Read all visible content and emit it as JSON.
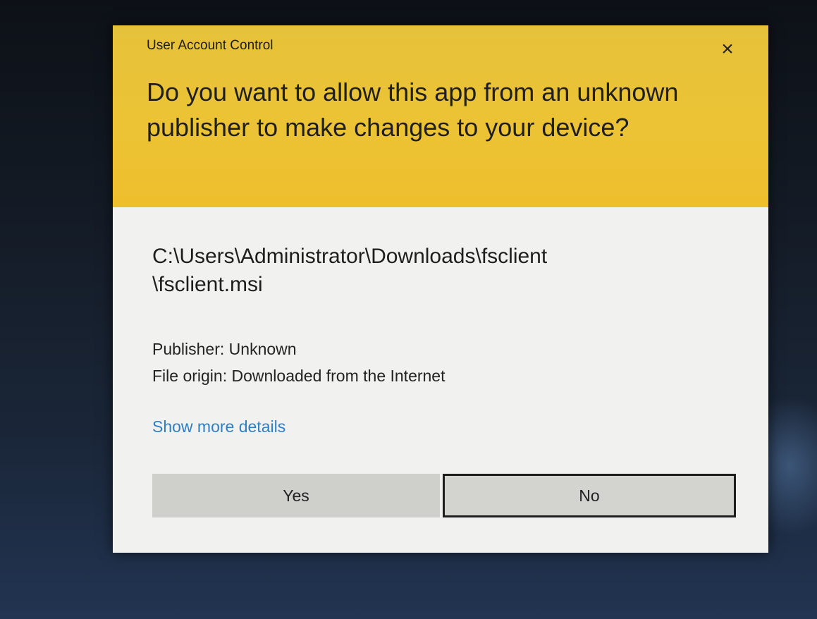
{
  "dialog": {
    "title": "User Account Control",
    "close_glyph": "×",
    "question": "Do you want to allow this app from an unknown publisher to make changes to your device?",
    "file_path": "C:\\Users\\Administrator\\Downloads\\fsclient\n\\fsclient.msi",
    "publisher_line": "Publisher: Unknown",
    "origin_line": "File origin: Downloaded from the Internet",
    "details_link": "Show more details",
    "yes_label": "Yes",
    "no_label": "No"
  },
  "colors": {
    "header": "#ecc334",
    "body": "#f1f1ef",
    "link": "#2f7fc7",
    "button": "#cfcfcc"
  },
  "icons": {
    "close": "close-icon"
  }
}
